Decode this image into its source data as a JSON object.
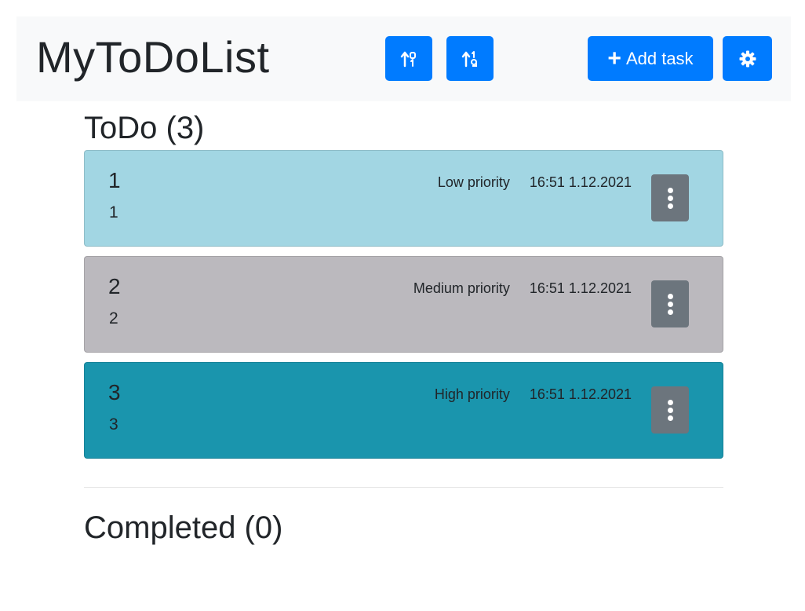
{
  "app": {
    "brand": "MyToDoList",
    "add_label": "Add task",
    "colors": {
      "primary": "#007bff",
      "navbar": "#f8f9fa",
      "low": "#a2d6e3",
      "medium": "#bbb9be",
      "high": "#1a95ad",
      "menu_button": "#6c757d"
    }
  },
  "todo": {
    "title": "ToDo (3)",
    "tasks": [
      {
        "title": "1",
        "description": "1",
        "priority": "Low priority",
        "datetime": "16:51 1.12.2021"
      },
      {
        "title": "2",
        "description": "2",
        "priority": "Medium priority",
        "datetime": "16:51 1.12.2021"
      },
      {
        "title": "3",
        "description": "3",
        "priority": "High priority",
        "datetime": "16:51 1.12.2021"
      }
    ]
  },
  "completed": {
    "title": "Completed (0)"
  },
  "icons": {
    "sort1": "sort-alpha-icon",
    "sort2": "sort-numeric-icon",
    "add": "plus-icon",
    "settings": "gear-icon",
    "menu": "vertical-ellipsis-icon"
  }
}
